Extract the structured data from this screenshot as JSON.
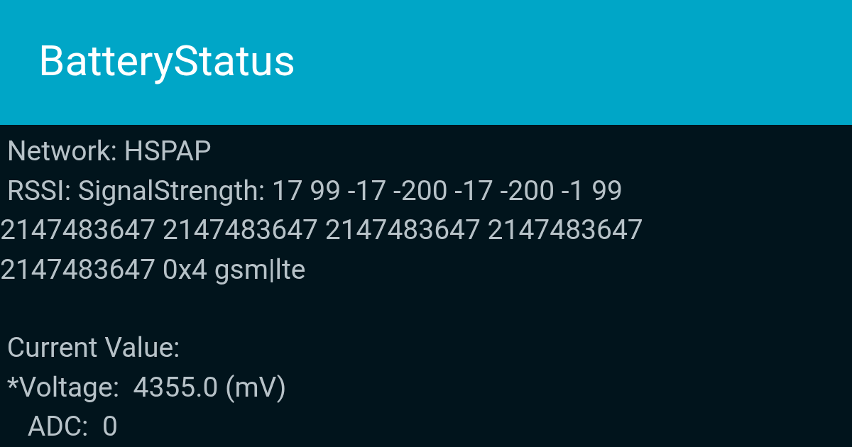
{
  "app_bar": {
    "title": "BatteryStatus"
  },
  "sections": [
    {
      "lines": [
        " Network: HSPAP",
        " RSSI: SignalStrength: 17 99 -17 -200 -17 -200 -1 99",
        "2147483647 2147483647 2147483647 2147483647",
        "2147483647 0x4 gsm|lte"
      ]
    },
    {
      "lines": [
        " Current Value:",
        " *Voltage:  4355.0 (mV)",
        "    ADC:  0"
      ]
    }
  ]
}
